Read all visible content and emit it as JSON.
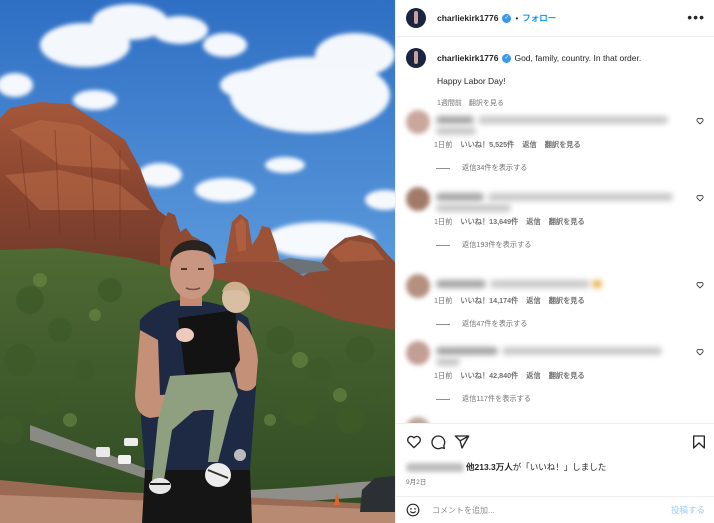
{
  "header": {
    "username": "charliekirk1776",
    "verified_icon": "✓",
    "dot": "•",
    "follow_label": "フォロー",
    "more_label": "•••"
  },
  "caption": {
    "username": "charliekirk1776",
    "text": "God, family, country. In that order.",
    "text2": "Happy Labor Day!",
    "time": "1週間前",
    "translate": "翻訳を見る"
  },
  "comments": [
    {
      "time": "1日前",
      "likes": "いいね！5,525件",
      "reply": "返信",
      "translate": "翻訳を見る",
      "view_replies": "返信34件を表示する"
    },
    {
      "time": "1日前",
      "likes": "いいね！13,649件",
      "reply": "返信",
      "translate": "翻訳を見る",
      "view_replies": "返信193件を表示する"
    },
    {
      "time": "1日前",
      "likes": "いいね！14,174件",
      "reply": "返信",
      "translate": "翻訳を見る",
      "view_replies": "返信47件を表示する"
    },
    {
      "time": "1日前",
      "likes": "いいね！42,840件",
      "reply": "返信",
      "translate": "翻訳を見る",
      "view_replies": "返信117件を表示する"
    }
  ],
  "likes_bar": {
    "others": "他213.3万人",
    "suffix": "が「いいね！」しました"
  },
  "date": "9月2日",
  "comment_input": {
    "placeholder": "コメントを追加...",
    "post_label": "投稿する"
  },
  "icons": {
    "like": "heart-icon",
    "comment": "comment-icon",
    "share": "share-icon",
    "save": "bookmark-icon",
    "emoji": "emoji-icon",
    "verified": "verified-badge-icon",
    "more": "more-options-icon"
  },
  "colors": {
    "accent": "#0095f6",
    "post_disabled": "#9ccbf8",
    "muted": "#737373",
    "verified": "#3897f0"
  }
}
